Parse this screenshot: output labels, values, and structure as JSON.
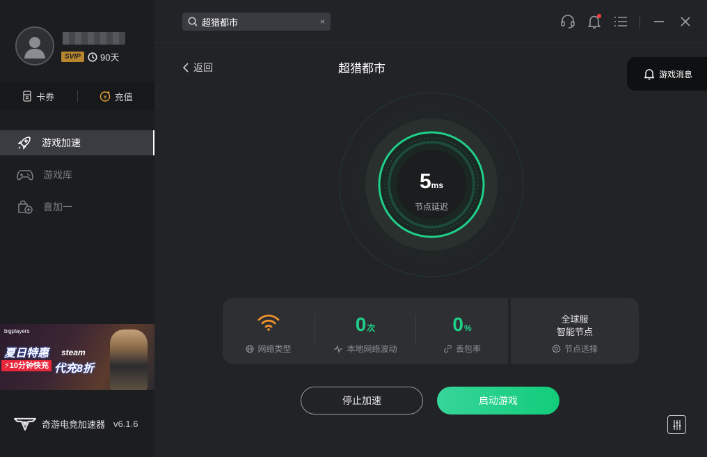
{
  "sidebar": {
    "vip_badge": "SVIP",
    "days": "90天",
    "wallet": {
      "coupon_label": "卡券",
      "recharge_label": "充值"
    },
    "nav": [
      {
        "label": "游戏加速",
        "icon": "rocket-icon"
      },
      {
        "label": "游戏库",
        "icon": "gamepad-icon"
      },
      {
        "label": "喜加一",
        "icon": "bag-plus-icon"
      }
    ],
    "banner": {
      "brand": "bigplayers",
      "headline": "夏日特惠",
      "steam": "steam",
      "tag": "⚡10分钟快充",
      "offer": "代充8折"
    },
    "app_name": "奇游电竞加速器",
    "version": "v6.1.6"
  },
  "search": {
    "value": "超猎都市",
    "clear": "×"
  },
  "header": {
    "back_label": "返回",
    "game_title": "超猎都市",
    "message_label": "游戏消息"
  },
  "gauge": {
    "latency_value": "5",
    "latency_unit": "ms",
    "latency_label": "节点延迟",
    "accent": "#1fd089"
  },
  "stats": {
    "network_type_label": "网络类型",
    "fluctuation_value": "0",
    "fluctuation_unit": "次",
    "fluctuation_label": "本地网络波动",
    "loss_value": "0",
    "loss_unit": "%",
    "loss_label": "丢包率",
    "server_line1": "全球服",
    "server_line2": "智能节点",
    "node_select_label": "节点选择"
  },
  "actions": {
    "stop_label": "停止加速",
    "start_label": "启动游戏"
  },
  "colors": {
    "accent_green": "#1fd089",
    "wifi_orange": "#f0922b",
    "vip_gold": "#b8862f"
  }
}
